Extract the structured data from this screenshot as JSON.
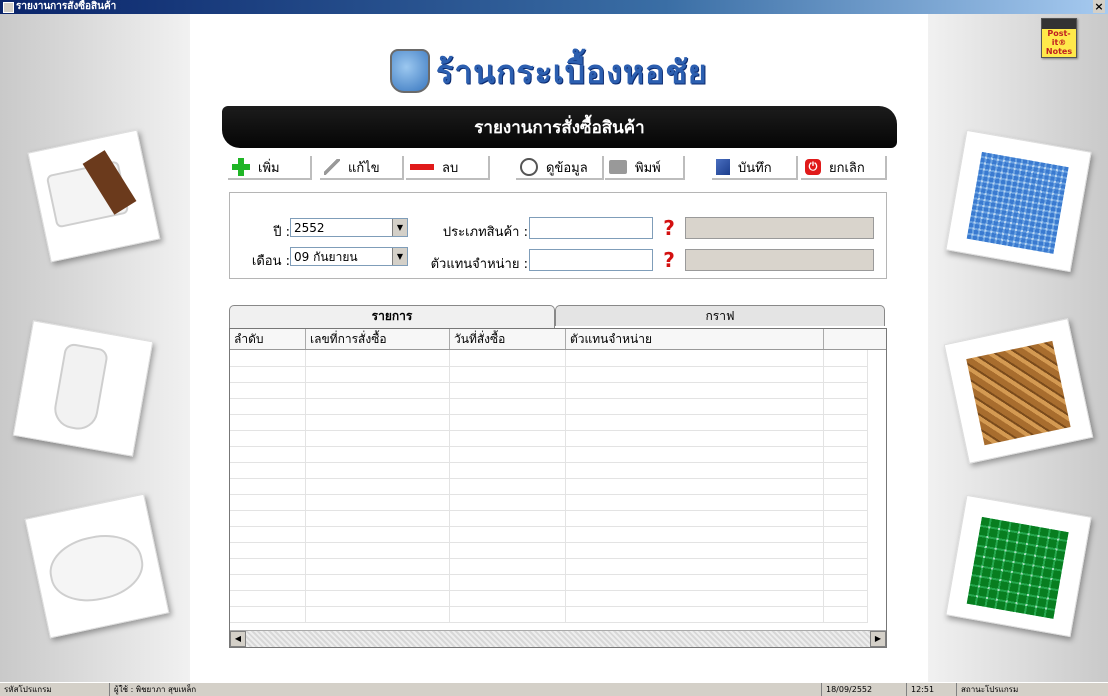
{
  "window": {
    "title": "รายงานการสั่งซื้อสินค้า",
    "close_label": "×"
  },
  "header": {
    "brand": "ร้านกระเบื้องหอชัย",
    "banner_title": "รายงานการสั่งซื้อสินค้า"
  },
  "toolbar": {
    "add": "เพิ่ม",
    "edit": "แก้ไข",
    "delete": "ลบ",
    "view": "ดูข้อมูล",
    "print": "พิมพ์",
    "save": "บันทึก",
    "cancel": "ยกเลิก"
  },
  "filters": {
    "year_label": "ปี :",
    "year_value": "2552",
    "month_label": "เดือน :",
    "month_value": "09 กันยายน",
    "product_type_label": "ประเภทสินค้า :",
    "product_type_value": "",
    "product_type_name": "",
    "agent_label": "ตัวแทนจำหน่าย :",
    "agent_value": "",
    "agent_name": "",
    "help_mark": "?"
  },
  "tabs": {
    "list": "รายการ",
    "graph": "กราฟ"
  },
  "grid": {
    "columns": [
      "ลำดับ",
      "เลขที่การสั่งซื้อ",
      "วันที่สั่งซื้อ",
      "ตัวแทนจำหน่าย"
    ],
    "rows": []
  },
  "postit": {
    "label": "Post-it® Notes"
  },
  "statusbar": {
    "program_code": "รหัสโปรแกรม",
    "user": "ผู้ใช้ : พิชยาภา สุขเหล็ก",
    "date": "18/09/2552",
    "time": "12:51",
    "program_status": "สถานะโปรแกรม"
  },
  "icons": {
    "add": "plus-icon",
    "edit": "pencil-icon",
    "delete": "minus-icon",
    "view": "magnifier-icon",
    "print": "printer-icon",
    "save": "disk-icon",
    "cancel": "power-icon"
  }
}
